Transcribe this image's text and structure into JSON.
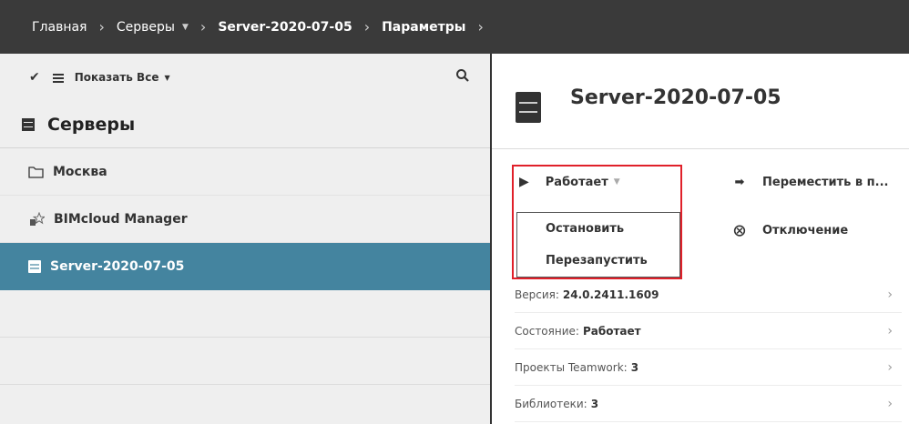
{
  "breadcrumb": {
    "home": "Главная",
    "servers": "Серверы",
    "server": "Server-2020-07-05",
    "params": "Параметры"
  },
  "toolbar": {
    "show_all": "Показать Все"
  },
  "left": {
    "section_title": "Серверы",
    "items": [
      {
        "label": "Москва",
        "icon": "folder-icon"
      },
      {
        "label": "BIMcloud Manager",
        "icon": "manager-icon"
      },
      {
        "label": "Server-2020-07-05",
        "icon": "server-icon",
        "selected": true
      }
    ]
  },
  "right": {
    "title": "Server-2020-07-05",
    "status_button": "Работает",
    "menu": [
      "Остановить",
      "Перезапустить"
    ],
    "actions": [
      "Переместить в п...",
      "Отключение"
    ],
    "info": [
      {
        "label": "Версия:",
        "value": "24.0.2411.1609"
      },
      {
        "label": "Состояние:",
        "value": "Работает"
      },
      {
        "label": "Проекты Teamwork:",
        "value": "3"
      },
      {
        "label": "Библиотеки:",
        "value": "3"
      }
    ]
  },
  "colors": {
    "topbar": "#3a3a3a",
    "selected": "#44849f",
    "highlight": "#e0202a"
  }
}
